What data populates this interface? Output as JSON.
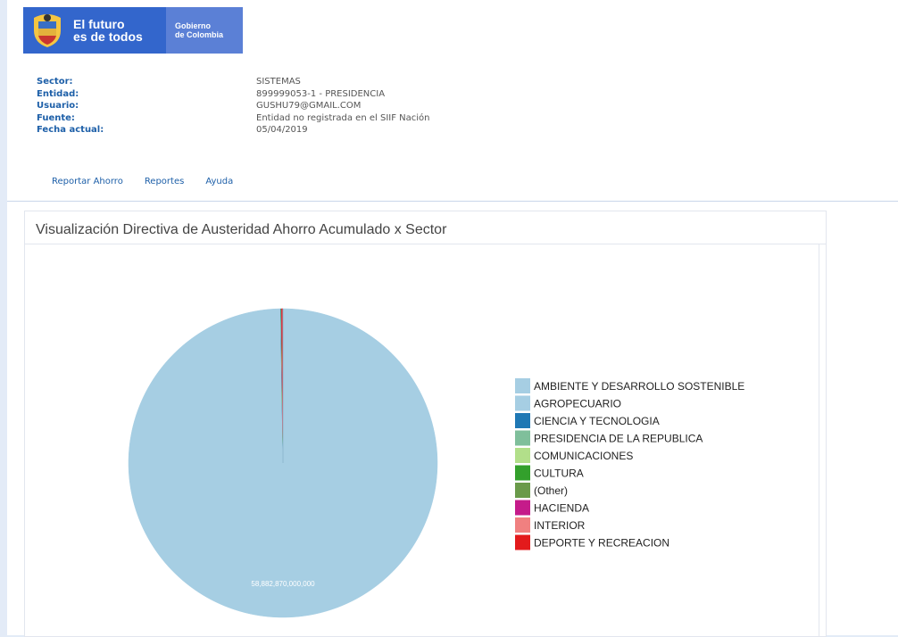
{
  "header": {
    "slogan_line1": "El futuro",
    "slogan_line2": "es de todos",
    "gov_line1": "Gobierno",
    "gov_line2": "de Colombia",
    "brand_color": "#3366cc"
  },
  "info": [
    {
      "label": "Sector:",
      "value": "SISTEMAS"
    },
    {
      "label": "Entidad:",
      "value": "899999053-1 - PRESIDENCIA"
    },
    {
      "label": "Usuario:",
      "value": "GUSHU79@GMAIL.COM"
    },
    {
      "label": "Fuente:",
      "value": "Entidad no registrada en el SIIF Nación"
    },
    {
      "label": "Fecha actual:",
      "value": "05/04/2019"
    }
  ],
  "nav": {
    "items": [
      "Reportar Ahorro",
      "Reportes",
      "Ayuda"
    ]
  },
  "panel": {
    "title": "Visualización Directiva de Austeridad Ahorro Acumulado x Sector"
  },
  "chart_data": {
    "type": "pie",
    "slice_label": "58,882,870,000,000",
    "categories": [
      "AMBIENTE Y DESARROLLO SOSTENIBLE",
      "AGROPECUARIO",
      "CIENCIA Y TECNOLOGIA",
      "PRESIDENCIA DE LA REPUBLICA",
      "COMUNICACIONES",
      "CULTURA",
      "(Other)",
      "HACIENDA",
      "INTERIOR",
      "DEPORTE Y RECREACION"
    ],
    "values": [
      58882870000000,
      40000000000,
      20000000000,
      10000000000,
      8000000000,
      8000000000,
      8000000000,
      8000000000,
      8000000000,
      80000000000
    ],
    "colors": [
      "#a6cee3",
      "#a6cee3",
      "#1f78b4",
      "#7fbf9b",
      "#b2df8a",
      "#33a02c",
      "#6a9a4a",
      "#c51b8a",
      "#f08080",
      "#e31a1c"
    ],
    "legend_position": "right"
  }
}
